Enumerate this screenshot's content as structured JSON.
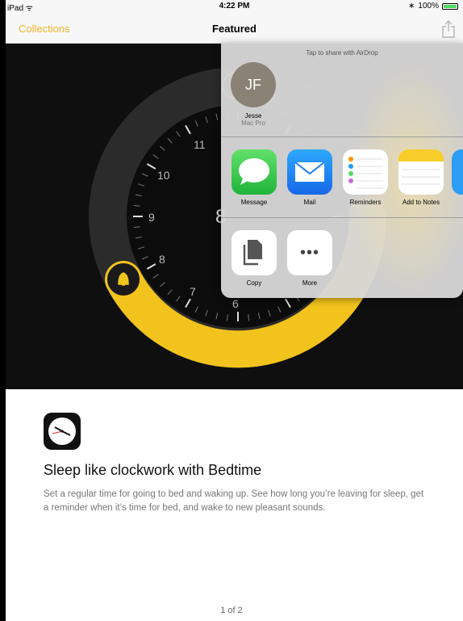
{
  "status_bar": {
    "device": "iPad",
    "time": "4:22 PM",
    "battery": "100%"
  },
  "nav": {
    "back_label": "Collections",
    "title": "Featured"
  },
  "hero": {
    "clock_numbers": [
      "11",
      "10",
      "9",
      "8",
      "7",
      "6",
      "8"
    ],
    "accent_color": "#f2c31c"
  },
  "share_sheet": {
    "airdrop_title": "Tap to share with AirDrop",
    "person": {
      "initials": "JF",
      "name": "Jesse",
      "device": "Mac Pro"
    },
    "apps": [
      {
        "label": "Message",
        "icon": "messages-icon"
      },
      {
        "label": "Mail",
        "icon": "mail-icon"
      },
      {
        "label": "Reminders",
        "icon": "reminders-icon"
      },
      {
        "label": "Add to Notes",
        "icon": "notes-icon"
      }
    ],
    "actions": [
      {
        "label": "Copy",
        "icon": "copy-icon"
      },
      {
        "label": "More",
        "icon": "more-icon"
      }
    ]
  },
  "content": {
    "headline": "Sleep like clockwork with Bedtime",
    "description": "Set a regular time for going to bed and waking up. See how long you’re leaving for sleep, get a reminder when it’s time for bed, and wake to new pleasant sounds.",
    "pager": "1 of 2"
  }
}
